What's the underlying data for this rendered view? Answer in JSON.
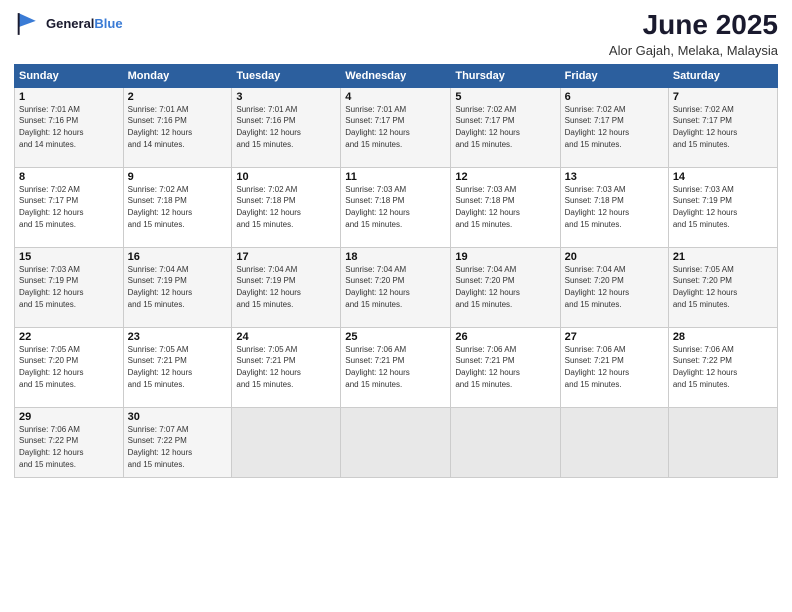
{
  "logo": {
    "line1": "General",
    "line2": "Blue"
  },
  "title": "June 2025",
  "location": "Alor Gajah, Melaka, Malaysia",
  "headers": [
    "Sunday",
    "Monday",
    "Tuesday",
    "Wednesday",
    "Thursday",
    "Friday",
    "Saturday"
  ],
  "weeks": [
    [
      {
        "day": "1",
        "sunrise": "7:01 AM",
        "sunset": "7:16 PM",
        "daylight": "12 hours and 14 minutes."
      },
      {
        "day": "2",
        "sunrise": "7:01 AM",
        "sunset": "7:16 PM",
        "daylight": "12 hours and 14 minutes."
      },
      {
        "day": "3",
        "sunrise": "7:01 AM",
        "sunset": "7:16 PM",
        "daylight": "12 hours and 15 minutes."
      },
      {
        "day": "4",
        "sunrise": "7:01 AM",
        "sunset": "7:17 PM",
        "daylight": "12 hours and 15 minutes."
      },
      {
        "day": "5",
        "sunrise": "7:02 AM",
        "sunset": "7:17 PM",
        "daylight": "12 hours and 15 minutes."
      },
      {
        "day": "6",
        "sunrise": "7:02 AM",
        "sunset": "7:17 PM",
        "daylight": "12 hours and 15 minutes."
      },
      {
        "day": "7",
        "sunrise": "7:02 AM",
        "sunset": "7:17 PM",
        "daylight": "12 hours and 15 minutes."
      }
    ],
    [
      {
        "day": "8",
        "sunrise": "7:02 AM",
        "sunset": "7:17 PM",
        "daylight": "12 hours and 15 minutes."
      },
      {
        "day": "9",
        "sunrise": "7:02 AM",
        "sunset": "7:18 PM",
        "daylight": "12 hours and 15 minutes."
      },
      {
        "day": "10",
        "sunrise": "7:02 AM",
        "sunset": "7:18 PM",
        "daylight": "12 hours and 15 minutes."
      },
      {
        "day": "11",
        "sunrise": "7:03 AM",
        "sunset": "7:18 PM",
        "daylight": "12 hours and 15 minutes."
      },
      {
        "day": "12",
        "sunrise": "7:03 AM",
        "sunset": "7:18 PM",
        "daylight": "12 hours and 15 minutes."
      },
      {
        "day": "13",
        "sunrise": "7:03 AM",
        "sunset": "7:18 PM",
        "daylight": "12 hours and 15 minutes."
      },
      {
        "day": "14",
        "sunrise": "7:03 AM",
        "sunset": "7:19 PM",
        "daylight": "12 hours and 15 minutes."
      }
    ],
    [
      {
        "day": "15",
        "sunrise": "7:03 AM",
        "sunset": "7:19 PM",
        "daylight": "12 hours and 15 minutes."
      },
      {
        "day": "16",
        "sunrise": "7:04 AM",
        "sunset": "7:19 PM",
        "daylight": "12 hours and 15 minutes."
      },
      {
        "day": "17",
        "sunrise": "7:04 AM",
        "sunset": "7:19 PM",
        "daylight": "12 hours and 15 minutes."
      },
      {
        "day": "18",
        "sunrise": "7:04 AM",
        "sunset": "7:20 PM",
        "daylight": "12 hours and 15 minutes."
      },
      {
        "day": "19",
        "sunrise": "7:04 AM",
        "sunset": "7:20 PM",
        "daylight": "12 hours and 15 minutes."
      },
      {
        "day": "20",
        "sunrise": "7:04 AM",
        "sunset": "7:20 PM",
        "daylight": "12 hours and 15 minutes."
      },
      {
        "day": "21",
        "sunrise": "7:05 AM",
        "sunset": "7:20 PM",
        "daylight": "12 hours and 15 minutes."
      }
    ],
    [
      {
        "day": "22",
        "sunrise": "7:05 AM",
        "sunset": "7:20 PM",
        "daylight": "12 hours and 15 minutes."
      },
      {
        "day": "23",
        "sunrise": "7:05 AM",
        "sunset": "7:21 PM",
        "daylight": "12 hours and 15 minutes."
      },
      {
        "day": "24",
        "sunrise": "7:05 AM",
        "sunset": "7:21 PM",
        "daylight": "12 hours and 15 minutes."
      },
      {
        "day": "25",
        "sunrise": "7:06 AM",
        "sunset": "7:21 PM",
        "daylight": "12 hours and 15 minutes."
      },
      {
        "day": "26",
        "sunrise": "7:06 AM",
        "sunset": "7:21 PM",
        "daylight": "12 hours and 15 minutes."
      },
      {
        "day": "27",
        "sunrise": "7:06 AM",
        "sunset": "7:21 PM",
        "daylight": "12 hours and 15 minutes."
      },
      {
        "day": "28",
        "sunrise": "7:06 AM",
        "sunset": "7:22 PM",
        "daylight": "12 hours and 15 minutes."
      }
    ],
    [
      {
        "day": "29",
        "sunrise": "7:06 AM",
        "sunset": "7:22 PM",
        "daylight": "12 hours and 15 minutes."
      },
      {
        "day": "30",
        "sunrise": "7:07 AM",
        "sunset": "7:22 PM",
        "daylight": "12 hours and 15 minutes."
      },
      null,
      null,
      null,
      null,
      null
    ]
  ],
  "labels": {
    "sunrise": "Sunrise:",
    "sunset": "Sunset:",
    "daylight": "Daylight:"
  },
  "colors": {
    "header_bg": "#2c5f9e",
    "odd_row": "#f5f5f5",
    "even_row": "#ffffff",
    "empty": "#e8e8e8"
  }
}
